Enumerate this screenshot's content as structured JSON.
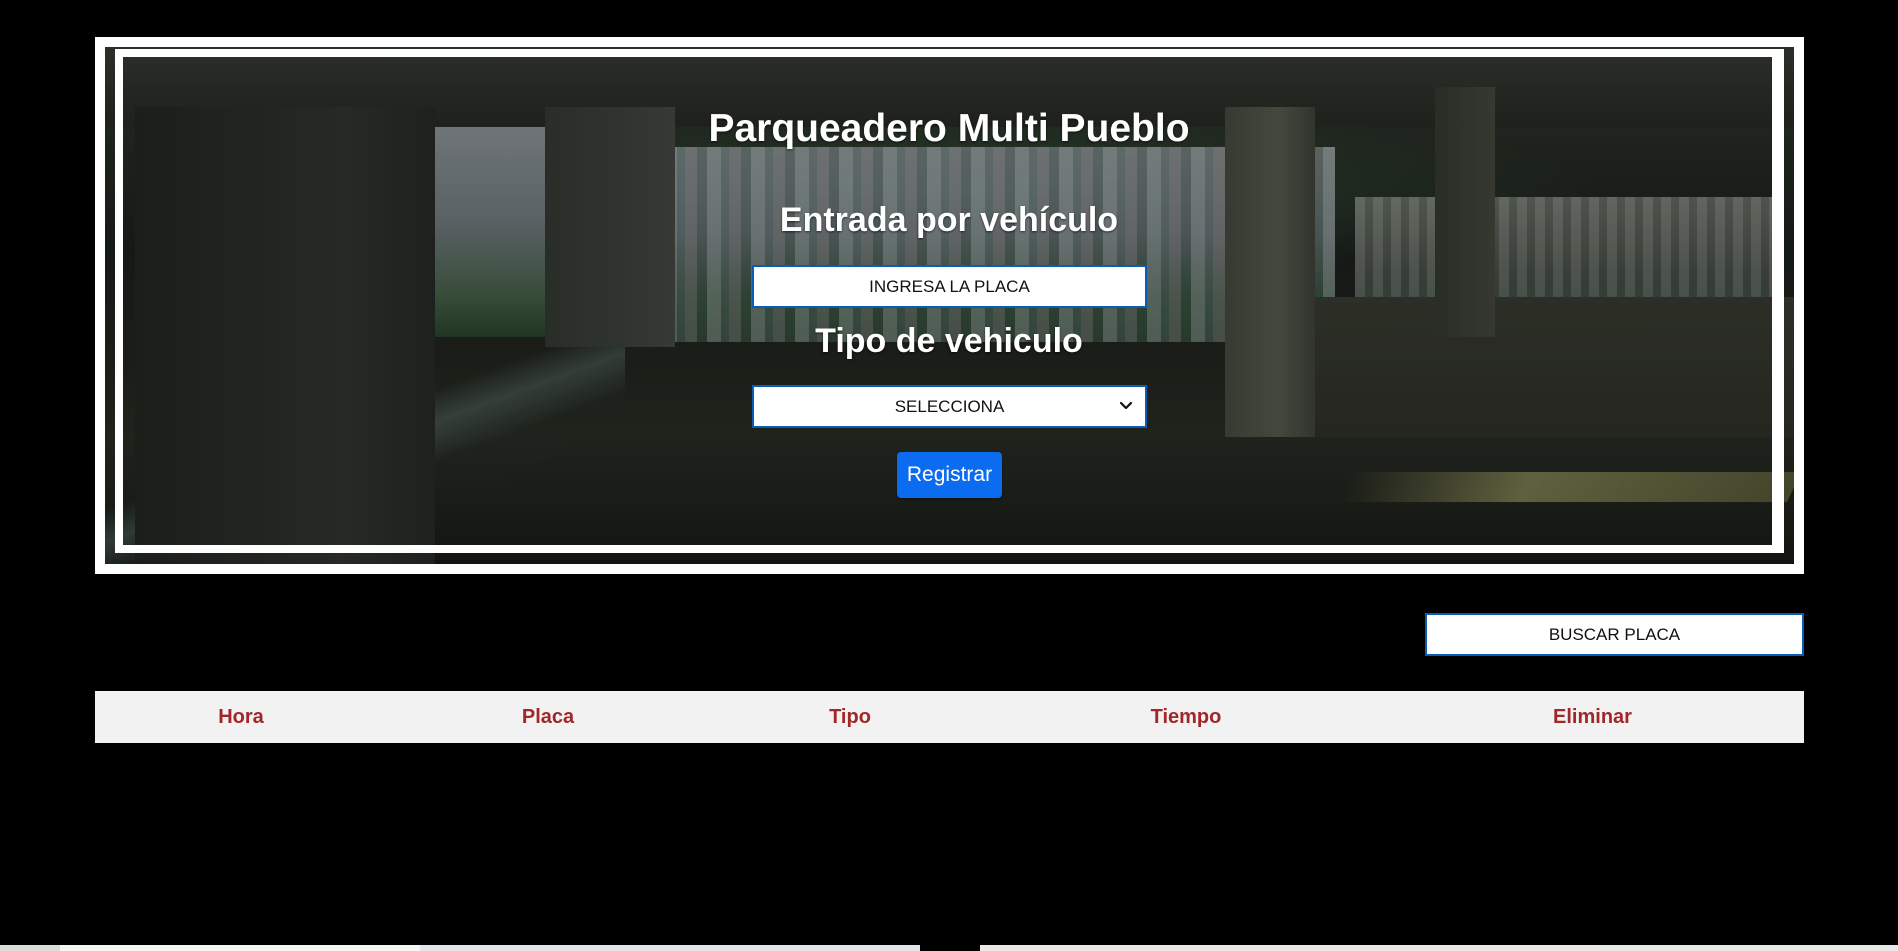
{
  "header": {
    "title": "Parqueadero Multi Pueblo"
  },
  "entry_form": {
    "entrada_label": "Entrada por vehículo",
    "plate_placeholder": "INGRESA LA PLACA",
    "tipo_label": "Tipo de vehiculo",
    "tipo_selected": "SELECCIONA",
    "register_label": "Registrar"
  },
  "search": {
    "placeholder": "BUSCAR PLACA"
  },
  "table": {
    "headers": [
      "Hora",
      "Placa",
      "Tipo",
      "Tiempo",
      "Eliminar"
    ],
    "rows": []
  },
  "colors": {
    "accent_button": "#0b6cf0",
    "input_border": "#0a5cb6",
    "header_text": "#a0282a",
    "table_header_bg": "#f2f2f2"
  }
}
